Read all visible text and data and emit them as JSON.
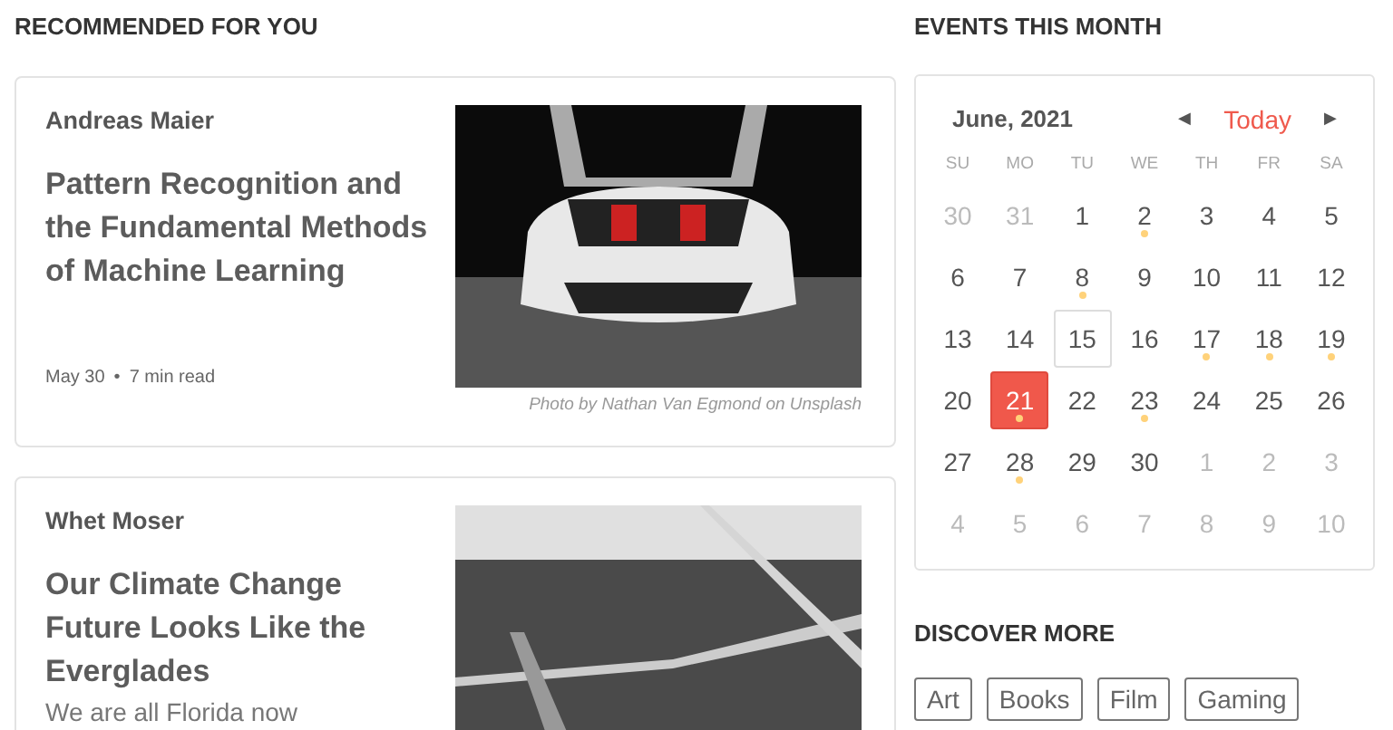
{
  "recommended": {
    "heading": "RECOMMENDED FOR YOU",
    "articles": [
      {
        "author": "Andreas Maier",
        "title": "Pattern Recognition and the Fundamental Methods of Machine Learning",
        "date": "May 30",
        "separator": "•",
        "read_time": "7 min read",
        "kind": "car",
        "caption": "Photo by Nathan Van Egmond on Unsplash"
      },
      {
        "author": "Whet Moser",
        "title": "Our Climate Change Future Looks Like the Everglades",
        "excerpt": "We are all Florida now",
        "kind": "landscape"
      }
    ]
  },
  "events": {
    "heading": "EVENTS THIS MONTH",
    "calendar": {
      "month": "June, 2021",
      "prev": "◀",
      "today_label": "Today",
      "next": "▶",
      "weekdays": [
        "SU",
        "MO",
        "TU",
        "WE",
        "TH",
        "FR",
        "SA"
      ],
      "days": [
        {
          "label": "30",
          "outside": true,
          "today": false,
          "selected": false,
          "event": false
        },
        {
          "label": "31",
          "outside": true,
          "today": false,
          "selected": false,
          "event": false
        },
        {
          "label": "1",
          "outside": false,
          "today": false,
          "selected": false,
          "event": false
        },
        {
          "label": "2",
          "outside": false,
          "today": false,
          "selected": false,
          "event": true
        },
        {
          "label": "3",
          "outside": false,
          "today": false,
          "selected": false,
          "event": false
        },
        {
          "label": "4",
          "outside": false,
          "today": false,
          "selected": false,
          "event": false
        },
        {
          "label": "5",
          "outside": false,
          "today": false,
          "selected": false,
          "event": false
        },
        {
          "label": "6",
          "outside": false,
          "today": false,
          "selected": false,
          "event": false
        },
        {
          "label": "7",
          "outside": false,
          "today": false,
          "selected": false,
          "event": false
        },
        {
          "label": "8",
          "outside": false,
          "today": false,
          "selected": false,
          "event": true
        },
        {
          "label": "9",
          "outside": false,
          "today": false,
          "selected": false,
          "event": false
        },
        {
          "label": "10",
          "outside": false,
          "today": false,
          "selected": false,
          "event": false
        },
        {
          "label": "11",
          "outside": false,
          "today": false,
          "selected": false,
          "event": false
        },
        {
          "label": "12",
          "outside": false,
          "today": false,
          "selected": false,
          "event": false
        },
        {
          "label": "13",
          "outside": false,
          "today": false,
          "selected": false,
          "event": false
        },
        {
          "label": "14",
          "outside": false,
          "today": false,
          "selected": false,
          "event": false
        },
        {
          "label": "15",
          "outside": false,
          "today": true,
          "selected": false,
          "event": false
        },
        {
          "label": "16",
          "outside": false,
          "today": false,
          "selected": false,
          "event": false
        },
        {
          "label": "17",
          "outside": false,
          "today": false,
          "selected": false,
          "event": true
        },
        {
          "label": "18",
          "outside": false,
          "today": false,
          "selected": false,
          "event": true
        },
        {
          "label": "19",
          "outside": false,
          "today": false,
          "selected": false,
          "event": true
        },
        {
          "label": "20",
          "outside": false,
          "today": false,
          "selected": false,
          "event": false
        },
        {
          "label": "21",
          "outside": false,
          "today": false,
          "selected": true,
          "event": true
        },
        {
          "label": "22",
          "outside": false,
          "today": false,
          "selected": false,
          "event": false
        },
        {
          "label": "23",
          "outside": false,
          "today": false,
          "selected": false,
          "event": true
        },
        {
          "label": "24",
          "outside": false,
          "today": false,
          "selected": false,
          "event": false
        },
        {
          "label": "25",
          "outside": false,
          "today": false,
          "selected": false,
          "event": false
        },
        {
          "label": "26",
          "outside": false,
          "today": false,
          "selected": false,
          "event": false
        },
        {
          "label": "27",
          "outside": false,
          "today": false,
          "selected": false,
          "event": false
        },
        {
          "label": "28",
          "outside": false,
          "today": false,
          "selected": false,
          "event": true
        },
        {
          "label": "29",
          "outside": false,
          "today": false,
          "selected": false,
          "event": false
        },
        {
          "label": "30",
          "outside": false,
          "today": false,
          "selected": false,
          "event": false
        },
        {
          "label": "1",
          "outside": true,
          "today": false,
          "selected": false,
          "event": false
        },
        {
          "label": "2",
          "outside": true,
          "today": false,
          "selected": false,
          "event": false
        },
        {
          "label": "3",
          "outside": true,
          "today": false,
          "selected": false,
          "event": false
        },
        {
          "label": "4",
          "outside": true,
          "today": false,
          "selected": false,
          "event": false
        },
        {
          "label": "5",
          "outside": true,
          "today": false,
          "selected": false,
          "event": false
        },
        {
          "label": "6",
          "outside": true,
          "today": false,
          "selected": false,
          "event": false
        },
        {
          "label": "7",
          "outside": true,
          "today": false,
          "selected": false,
          "event": false
        },
        {
          "label": "8",
          "outside": true,
          "today": false,
          "selected": false,
          "event": false
        },
        {
          "label": "9",
          "outside": true,
          "today": false,
          "selected": false,
          "event": false
        },
        {
          "label": "10",
          "outside": true,
          "today": false,
          "selected": false,
          "event": false
        }
      ]
    }
  },
  "discover": {
    "heading": "DISCOVER MORE",
    "tags": [
      "Art",
      "Books",
      "Film",
      "Gaming"
    ]
  }
}
